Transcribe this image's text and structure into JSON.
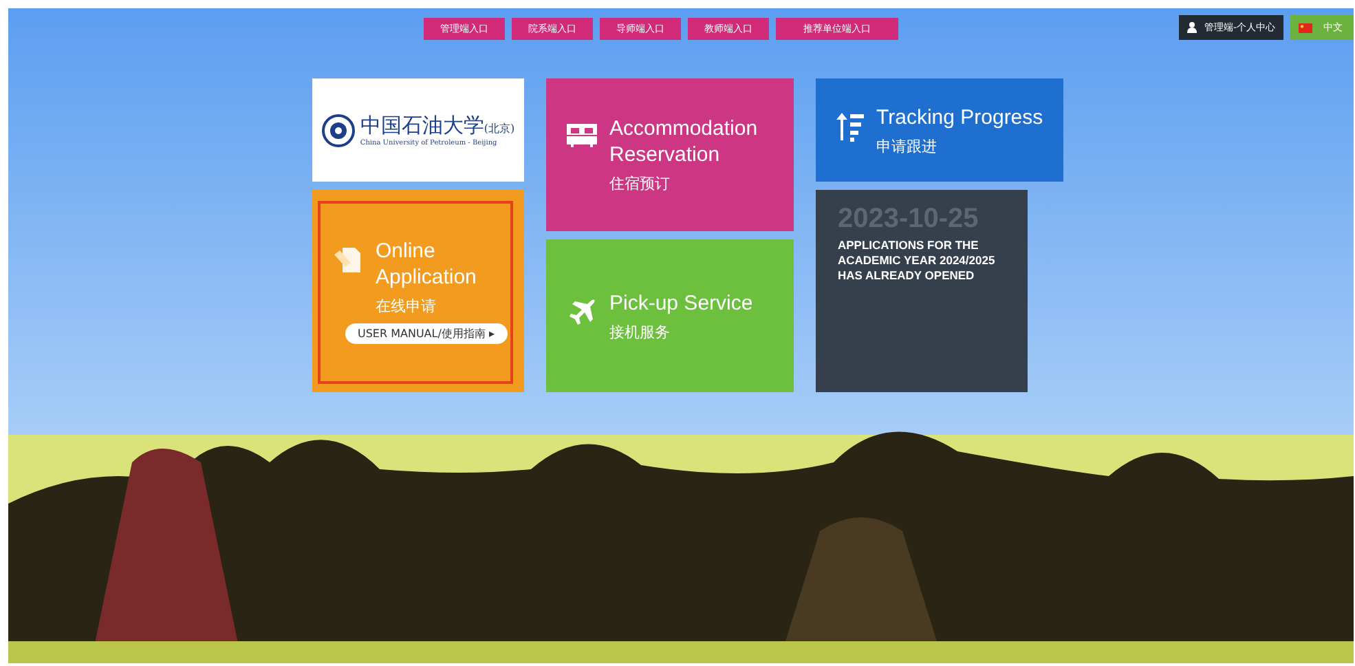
{
  "top_nav": [
    {
      "label": "管理端入口"
    },
    {
      "label": "院系端入口"
    },
    {
      "label": "导师端入口"
    },
    {
      "label": "教师端入口"
    },
    {
      "label": "推荐单位端入口"
    }
  ],
  "user_center": {
    "label": "管理端-个人中心"
  },
  "language": {
    "label": "中文"
  },
  "logo": {
    "name_cn": "中国石油大学",
    "name_suffix": "(北京)",
    "name_en": "China University of Petroleum - Beijing"
  },
  "tiles": [
    {
      "kind": "application",
      "title": "Online Application",
      "subtitle": "在线申请",
      "manual_button": "USER MANUAL/使用指南 ▸",
      "selected": true
    },
    {
      "kind": "accommodation",
      "title": "Accommodation Reservation",
      "subtitle": "住宿预订"
    },
    {
      "kind": "pickup",
      "title": "Pick-up Service",
      "subtitle": "接机服务"
    },
    {
      "kind": "tracking",
      "title": "Tracking Progress",
      "subtitle": "申请跟进"
    }
  ],
  "notice": {
    "date": "2023-10-25",
    "text": "APPLICATIONS FOR THE ACADEMIC YEAR 2024/2025 HAS ALREADY OPENED"
  }
}
